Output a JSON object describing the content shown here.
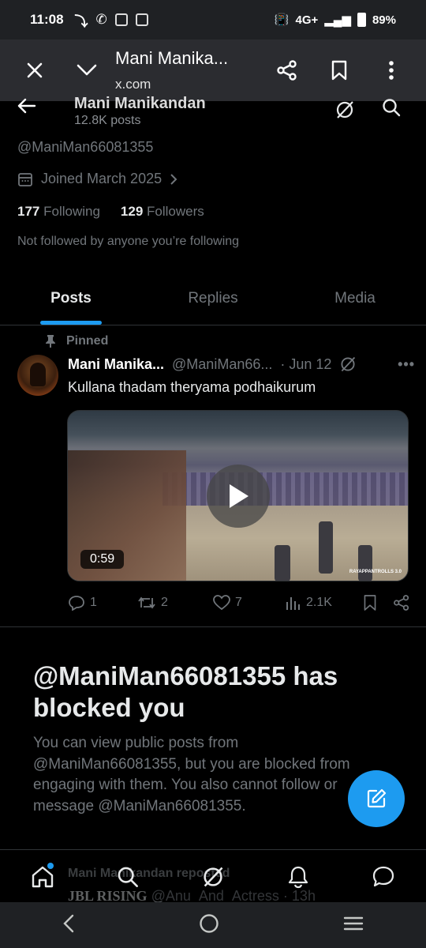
{
  "status_bar": {
    "time": "11:08",
    "network": "4G+",
    "battery": "89%"
  },
  "browser": {
    "title": "Mani Manika...",
    "url": "x.com"
  },
  "profile": {
    "name": "Mani Manikandan",
    "posts_count": "12.8K posts",
    "handle": "@ManiMan66081355",
    "joined": "Joined March 2025",
    "following_count": "177",
    "following_label": "Following",
    "followers_count": "129",
    "followers_label": "Followers",
    "not_followed": "Not followed by anyone you’re following"
  },
  "tabs": [
    {
      "label": "Posts",
      "active": true
    },
    {
      "label": "Replies",
      "active": false
    },
    {
      "label": "Media",
      "active": false
    }
  ],
  "pinned_post": {
    "pinned_label": "Pinned",
    "author": "Mani Manika...",
    "handle": "@ManiMan66...",
    "date": "· Jun 12",
    "text": "Kullana thadam theryama podhaikurum",
    "video_duration": "0:59",
    "watermark": "RAYAPPANTROLLS 3.0",
    "replies": "1",
    "reposts": "2",
    "likes": "7",
    "views": "2.1K"
  },
  "blocked": {
    "title": "@ManiMan66081355 has blocked you",
    "body": "You can view public posts from @ManiMan66081355, but you are blocked from engaging with them. You also cannot follow or message @ManiMan66081355."
  },
  "next_post_peek": {
    "repost_label": "Mani Manikandan reposted",
    "author": "JBL RISING",
    "handle_date": "@Anu_And_Actress · 13h"
  },
  "colors": {
    "accent": "#1d9bf0",
    "muted": "#71767b",
    "background": "#000000"
  }
}
